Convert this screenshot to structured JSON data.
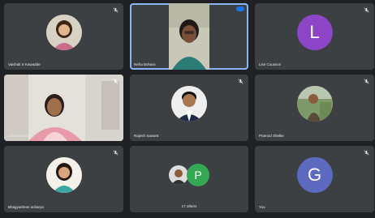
{
  "participants": [
    {
      "name": "Vaishali S Kawadde",
      "kind": "photo",
      "icon": "avatar-woman-icon"
    },
    {
      "name": "Neha Bohara",
      "kind": "video-center",
      "speaking": true,
      "icon": "camera-feed"
    },
    {
      "name": "Lise Cousson",
      "kind": "letter",
      "letter": "L",
      "color": "#8e44c6"
    },
    {
      "name": "Lise Cousson",
      "kind": "video",
      "icon": "camera-feed"
    },
    {
      "name": "Rajesh Sawant",
      "kind": "photo",
      "icon": "avatar-man-icon"
    },
    {
      "name": "Pramod Shelke",
      "kind": "photo",
      "icon": "avatar-outdoor-icon"
    },
    {
      "name": "Bhagyashree acharya",
      "kind": "photo",
      "icon": "avatar-woman-icon"
    },
    {
      "name": "17 others",
      "kind": "group",
      "letter": "P",
      "color": "#34a853"
    },
    {
      "name": "You",
      "kind": "letter",
      "letter": "G",
      "color": "#5c6bc0"
    }
  ]
}
